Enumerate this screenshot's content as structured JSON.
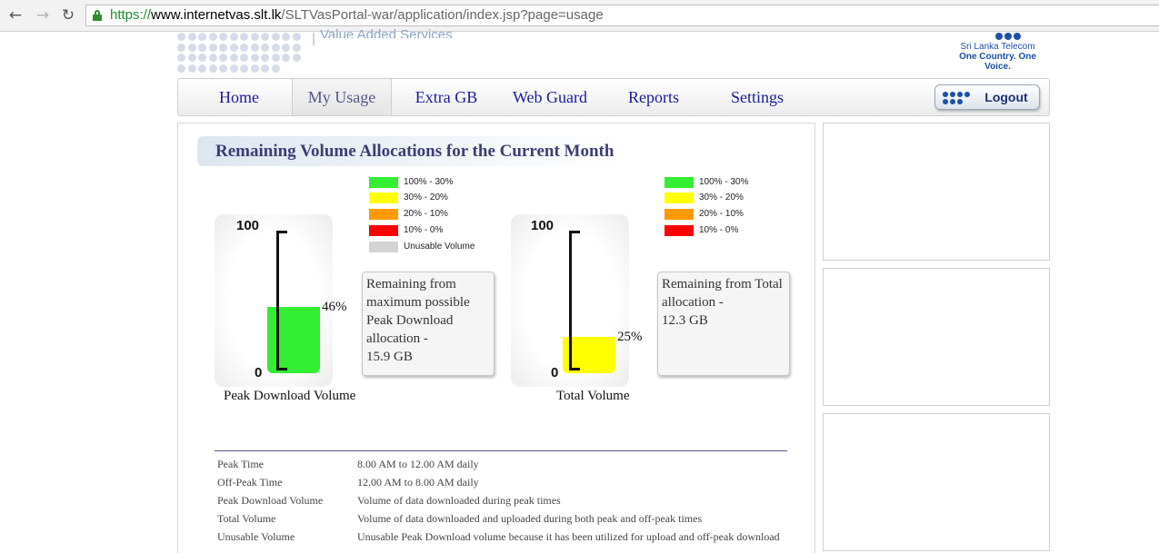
{
  "browser": {
    "url_scheme": "https://",
    "url_host": "www.internetvas.slt.lk",
    "url_path": "/SLTVasPortal-war/application/index.jsp?page=usage",
    "back_icon": "back-arrow-icon",
    "forward_icon": "forward-arrow-icon",
    "reload_icon": "reload-icon"
  },
  "header": {
    "service_text": "Value Added Services",
    "brand_name": "Sri Lanka Telecom",
    "brand_tagline": "One Country. One Voice.",
    "brand_color": "#1d4fa8"
  },
  "nav": {
    "items": [
      {
        "label": "Home"
      },
      {
        "label": "My Usage"
      },
      {
        "label": "Extra GB"
      },
      {
        "label": "Web Guard"
      },
      {
        "label": "Reports"
      },
      {
        "label": "Settings"
      }
    ],
    "active_index": 1,
    "logout_label": "Logout"
  },
  "usage": {
    "title": "Remaining Volume Allocations for the Current Month",
    "legend": [
      {
        "label": "100%  - 30%",
        "color": "#33ee33"
      },
      {
        "label": "30%   - 20%",
        "color": "#ffff00"
      },
      {
        "label": "20%   - 10%",
        "color": "#ff9900"
      },
      {
        "label": "10%   - 0%",
        "color": "#ff0000"
      },
      {
        "label": "Unusable Volume",
        "color": "#d3d3d3"
      }
    ],
    "gauges": [
      {
        "caption": "Peak Download Volume",
        "axis_top": "100",
        "axis_bottom": "0",
        "percent_label": "46%",
        "percent": 46,
        "fill_color": "#33ee33",
        "callout": [
          "Remaining from",
          "maximum possible",
          "Peak Download",
          "allocation -",
          "15.9 GB"
        ]
      },
      {
        "caption": "Total Volume",
        "axis_top": "100",
        "axis_bottom": "0",
        "percent_label": "25%",
        "percent": 25,
        "fill_color": "#ffff00",
        "callout": [
          "Remaining from Total",
          "allocation -",
          "12.3 GB"
        ]
      }
    ]
  },
  "definitions": [
    {
      "term": "Peak Time",
      "desc": "8.00 AM to 12.00 AM daily"
    },
    {
      "term": "Off-Peak Time",
      "desc": "12.00 AM to 8.00 AM daily"
    },
    {
      "term": "Peak Download Volume",
      "desc": "Volume of data downloaded during peak times"
    },
    {
      "term": "Total Volume",
      "desc": "Volume of data downloaded and uploaded during both peak and off-peak times"
    },
    {
      "term": "Unusable Volume",
      "desc": "Unusable Peak Download volume because it has been utilized for upload and off-peak download"
    }
  ]
}
